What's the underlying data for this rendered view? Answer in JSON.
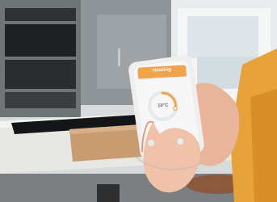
{
  "scene": {
    "description_free": true
  },
  "app": {
    "title": "Heating",
    "subtitle": "",
    "temperature": "19°C",
    "colors": {
      "header": "#f2a24c",
      "dial_track": "#e7eaec",
      "dial_active": "#f2a24c"
    }
  }
}
